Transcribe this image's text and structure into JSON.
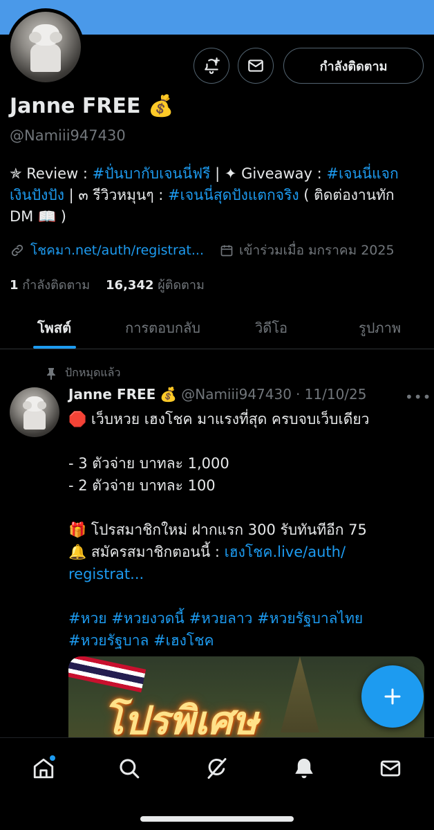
{
  "profile": {
    "name": "Janne FREE",
    "name_emoji": "💰",
    "handle": "@Namiii947430",
    "follow_button": "กำลังติดตาม",
    "bio": {
      "prefix1": "✯ Review : ",
      "tag1": "#ปั่นบากับเจนนี่ฟรี",
      "sep1": " | ✦ Giveaway : ",
      "tag2a": "#เจนนี่แจก",
      "tag2b": "เงินปังปัง",
      "mid": " | ๓ รีวิวหมุนๆ : ",
      "tag3": "#เจนนี่สุดปังแตกจริง",
      "suffix1": " ( ติดต่องานทัก",
      "suffix2": "DM 📖 )"
    },
    "link": "โชคมา.net/auth/registrat...",
    "joined": "เข้าร่วมเมื่อ มกราคม 2025",
    "following_count": "1",
    "following_label": "กำลังติดตาม",
    "followers_count": "16,342",
    "followers_label": "ผู้ติดตาม"
  },
  "tabs": [
    "โพสต์",
    "การตอบกลับ",
    "วิดีโอ",
    "รูปภาพ"
  ],
  "post": {
    "pinned_label": "ปักหมุดแล้ว",
    "author": "Janne FREE",
    "author_emoji": "💰",
    "handle": "@Namiii947430",
    "date": "· 11/10/25",
    "line1": "🛑 เว็บหวย เฮงโชค มาแรงที่สุด ครบจบเว็บเดียว",
    "line2": "- 3 ตัวจ่าย บาทละ 1,000",
    "line3": "- 2 ตัวจ่าย บาทละ 100",
    "line4": "🎁 โปรสมาชิกใหม่ ฝากแรก 300 รับทันทีอีก 75",
    "line5_prefix": "🔔 สมัครสมาชิกตอนนี้ : ",
    "line5_link": "เฮงโชค.live/auth/",
    "line6_link": "registrat...",
    "hashtags1": "#หวย #หวยงวดนี้ #หวยลาว #หวยรัฐบาลไทย",
    "hashtags2": "#หวยรัฐบาล #เฮงโชค",
    "media_text": "โปรพิเศษ"
  },
  "bottom_nav": [
    "home-icon",
    "search-icon",
    "grok-icon",
    "notifications-icon",
    "messages-icon"
  ],
  "colors": {
    "accent": "#1d9bf0",
    "banner": "#4a99e9",
    "muted": "#71767b"
  }
}
